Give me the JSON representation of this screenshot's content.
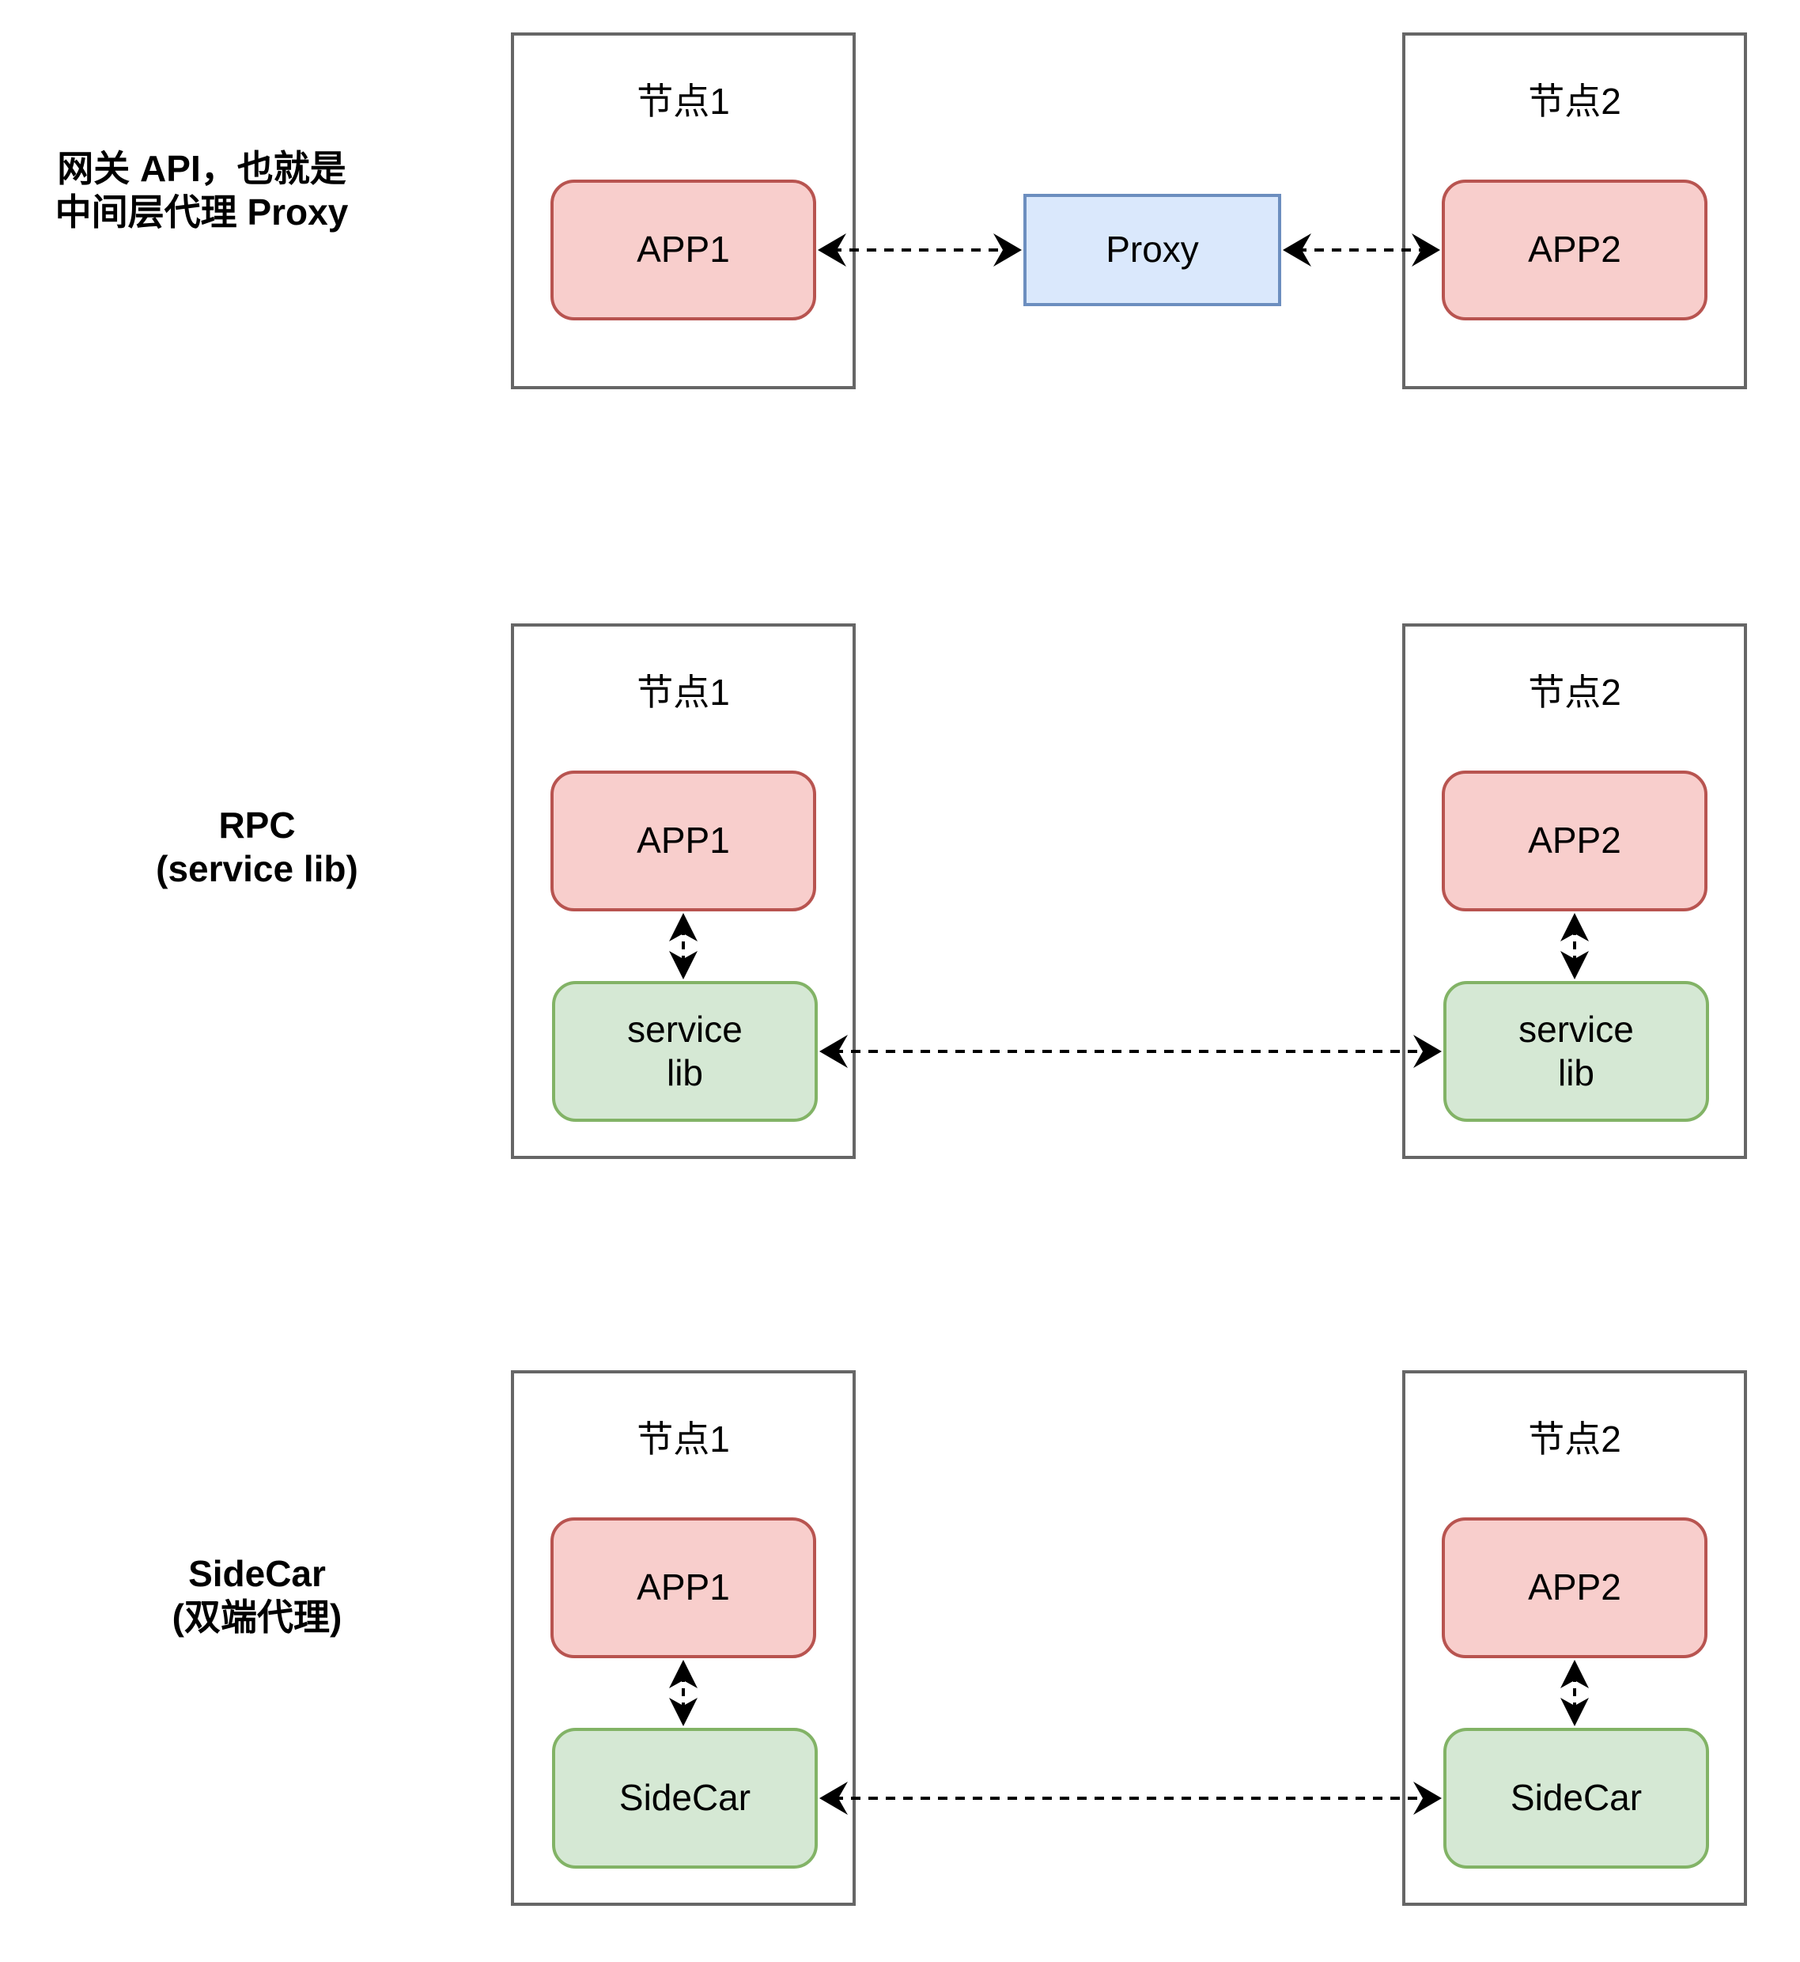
{
  "colors": {
    "app_fill": "#f8cecc",
    "app_stroke": "#b85450",
    "lib_fill": "#d5e8d4",
    "lib_stroke": "#82b366",
    "proxy_fill": "#dae8fc",
    "proxy_stroke": "#6c8ebf",
    "node_stroke": "#666666",
    "edge": "#000000"
  },
  "sections": [
    {
      "label_line1": "网关 API，也就是",
      "label_line2": "中间层代理 Proxy",
      "node1_title": "节点1",
      "node2_title": "节点2",
      "app1": "APP1",
      "app2": "APP2",
      "middle": "Proxy",
      "edges": [
        "APP1 <-> Proxy",
        "Proxy <-> APP2"
      ]
    },
    {
      "label_line1": "RPC",
      "label_line2": "(service lib)",
      "node1_title": "节点1",
      "node2_title": "节点2",
      "app1": "APP1",
      "app2": "APP2",
      "lib1_line1": "service",
      "lib1_line2": "lib",
      "lib2_line1": "service",
      "lib2_line2": "lib",
      "edges": [
        "APP1 <-> service lib",
        "APP2 <-> service lib",
        "service lib <-> service lib"
      ]
    },
    {
      "label_line1": "SideCar",
      "label_line2": "(双端代理)",
      "node1_title": "节点1",
      "node2_title": "节点2",
      "app1": "APP1",
      "app2": "APP2",
      "lib1": "SideCar",
      "lib2": "SideCar",
      "edges": [
        "APP1 <-> SideCar",
        "APP2 <-> SideCar",
        "SideCar <-> SideCar"
      ]
    }
  ]
}
